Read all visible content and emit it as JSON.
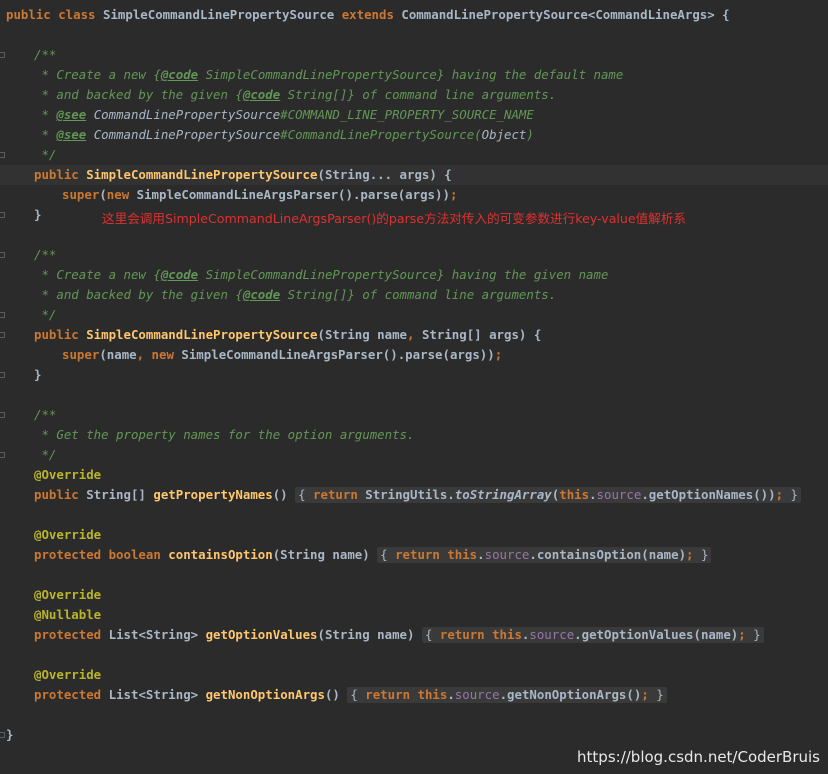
{
  "lines": [
    {
      "id": "class-decl",
      "indent": 0,
      "tokens": [
        {
          "t": "public class ",
          "c": "kw"
        },
        {
          "t": "SimpleCommandLinePropertySource ",
          "c": "cls"
        },
        {
          "t": "extends ",
          "c": "kw"
        },
        {
          "t": "CommandLinePropertySource<CommandLineArgs> {",
          "c": "cls"
        }
      ]
    },
    {
      "id": "blank-1",
      "indent": 0,
      "tokens": []
    },
    {
      "id": "doc1-open",
      "indent": 1,
      "tokens": [
        {
          "t": "/**",
          "c": "cm"
        }
      ]
    },
    {
      "id": "doc1-l1",
      "indent": 1,
      "tokens": [
        {
          "t": " * Create a new ",
          "c": "cm"
        },
        {
          "t": "{",
          "c": "cm"
        },
        {
          "t": "@code",
          "c": "cm-tag"
        },
        {
          "t": " SimpleCommandLinePropertySource} having the default name",
          "c": "cm"
        }
      ]
    },
    {
      "id": "doc1-l2",
      "indent": 1,
      "tokens": [
        {
          "t": " * and backed by the given ",
          "c": "cm"
        },
        {
          "t": "{",
          "c": "cm"
        },
        {
          "t": "@code",
          "c": "cm-tag"
        },
        {
          "t": " String[]} of command line arguments.",
          "c": "cm"
        }
      ]
    },
    {
      "id": "doc1-l3",
      "indent": 1,
      "tokens": [
        {
          "t": " * ",
          "c": "cm"
        },
        {
          "t": "@see",
          "c": "cm-tag"
        },
        {
          "t": " CommandLinePropertySource",
          "c": "cm-ref"
        },
        {
          "t": "#COMMAND_LINE_PROPERTY_SOURCE_NAME",
          "c": "cm"
        }
      ]
    },
    {
      "id": "doc1-l4",
      "indent": 1,
      "tokens": [
        {
          "t": " * ",
          "c": "cm"
        },
        {
          "t": "@see",
          "c": "cm-tag"
        },
        {
          "t": " CommandLinePropertySource",
          "c": "cm-ref"
        },
        {
          "t": "#CommandLinePropertySource(",
          "c": "cm"
        },
        {
          "t": "Object",
          "c": "cm-ref"
        },
        {
          "t": ")",
          "c": "cm"
        }
      ]
    },
    {
      "id": "doc1-close",
      "indent": 1,
      "tokens": [
        {
          "t": " */",
          "c": "cm"
        }
      ]
    },
    {
      "id": "ctor1-sig",
      "indent": 1,
      "current": true,
      "tokens": [
        {
          "t": "public ",
          "c": "kw"
        },
        {
          "t": "SimpleCommandLinePropertySource",
          "c": "fn"
        },
        {
          "t": "(String... args) {",
          "c": "plain-b"
        }
      ]
    },
    {
      "id": "ctor1-body",
      "indent": 2,
      "tokens": [
        {
          "t": "super",
          "c": "kw"
        },
        {
          "t": "(",
          "c": "plain-b"
        },
        {
          "t": "new ",
          "c": "kw"
        },
        {
          "t": "SimpleCommandLineArgsParser().parse(args))",
          "c": "plain-b"
        },
        {
          "t": ";",
          "c": "kw"
        }
      ]
    },
    {
      "id": "ctor1-close",
      "indent": 1,
      "tokens": [
        {
          "t": "}",
          "c": "plain-b"
        }
      ]
    },
    {
      "id": "blank-2",
      "indent": 0,
      "tokens": []
    },
    {
      "id": "doc2-open",
      "indent": 1,
      "tokens": [
        {
          "t": "/**",
          "c": "cm"
        }
      ]
    },
    {
      "id": "doc2-l1",
      "indent": 1,
      "tokens": [
        {
          "t": " * Create a new ",
          "c": "cm"
        },
        {
          "t": "{",
          "c": "cm"
        },
        {
          "t": "@code",
          "c": "cm-tag"
        },
        {
          "t": " SimpleCommandLinePropertySource} having the given name",
          "c": "cm"
        }
      ]
    },
    {
      "id": "doc2-l2",
      "indent": 1,
      "tokens": [
        {
          "t": " * and backed by the given ",
          "c": "cm"
        },
        {
          "t": "{",
          "c": "cm"
        },
        {
          "t": "@code",
          "c": "cm-tag"
        },
        {
          "t": " String[]} of command line arguments.",
          "c": "cm"
        }
      ]
    },
    {
      "id": "doc2-close",
      "indent": 1,
      "tokens": [
        {
          "t": " */",
          "c": "cm"
        }
      ]
    },
    {
      "id": "ctor2-sig",
      "indent": 1,
      "tokens": [
        {
          "t": "public ",
          "c": "kw"
        },
        {
          "t": "SimpleCommandLinePropertySource",
          "c": "fn"
        },
        {
          "t": "(String name",
          "c": "plain-b"
        },
        {
          "t": ", ",
          "c": "kw"
        },
        {
          "t": "String[] args) {",
          "c": "plain-b"
        }
      ]
    },
    {
      "id": "ctor2-body",
      "indent": 2,
      "tokens": [
        {
          "t": "super",
          "c": "kw"
        },
        {
          "t": "(name",
          "c": "plain-b"
        },
        {
          "t": ", ",
          "c": "kw"
        },
        {
          "t": "new ",
          "c": "kw"
        },
        {
          "t": "SimpleCommandLineArgsParser().parse(args))",
          "c": "plain-b"
        },
        {
          "t": ";",
          "c": "kw"
        }
      ]
    },
    {
      "id": "ctor2-close",
      "indent": 1,
      "tokens": [
        {
          "t": "}",
          "c": "plain-b"
        }
      ]
    },
    {
      "id": "blank-3",
      "indent": 0,
      "tokens": []
    },
    {
      "id": "doc3-open",
      "indent": 1,
      "tokens": [
        {
          "t": "/**",
          "c": "cm"
        }
      ]
    },
    {
      "id": "doc3-l1",
      "indent": 1,
      "tokens": [
        {
          "t": " * Get the property names for the option arguments.",
          "c": "cm"
        }
      ]
    },
    {
      "id": "doc3-close",
      "indent": 1,
      "tokens": [
        {
          "t": " */",
          "c": "cm"
        }
      ]
    },
    {
      "id": "ann-1",
      "indent": 1,
      "tokens": [
        {
          "t": "@Override",
          "c": "ann"
        }
      ]
    },
    {
      "id": "m1",
      "indent": 1,
      "tokens": [
        {
          "t": "public ",
          "c": "kw"
        },
        {
          "t": "String[] ",
          "c": "plain-b"
        },
        {
          "t": "getPropertyNames",
          "c": "fn"
        },
        {
          "t": "() ",
          "c": "plain-b"
        },
        {
          "fold": [
            {
              "t": "{ ",
              "c": "plain"
            },
            {
              "t": "return ",
              "c": "kw"
            },
            {
              "t": "StringUtils.",
              "c": "plain-b"
            },
            {
              "t": "toStringArray",
              "c": "static-call"
            },
            {
              "t": "(",
              "c": "plain-b"
            },
            {
              "t": "this",
              "c": "kw"
            },
            {
              "t": ".",
              "c": "plain-b"
            },
            {
              "t": "source",
              "c": "fld"
            },
            {
              "t": ".getOptionNames())",
              "c": "plain-b"
            },
            {
              "t": ";",
              "c": "kw"
            },
            {
              "t": " }",
              "c": "plain"
            }
          ]
        }
      ]
    },
    {
      "id": "blank-4",
      "indent": 0,
      "tokens": []
    },
    {
      "id": "ann-2",
      "indent": 1,
      "tokens": [
        {
          "t": "@Override",
          "c": "ann"
        }
      ]
    },
    {
      "id": "m2",
      "indent": 1,
      "tokens": [
        {
          "t": "protected boolean ",
          "c": "kw"
        },
        {
          "t": "containsOption",
          "c": "fn"
        },
        {
          "t": "(String name) ",
          "c": "plain-b"
        },
        {
          "fold": [
            {
              "t": "{ ",
              "c": "plain"
            },
            {
              "t": "return this",
              "c": "kw"
            },
            {
              "t": ".",
              "c": "plain-b"
            },
            {
              "t": "source",
              "c": "fld"
            },
            {
              "t": ".containsOption(name)",
              "c": "plain-b"
            },
            {
              "t": ";",
              "c": "kw"
            },
            {
              "t": " }",
              "c": "plain"
            }
          ]
        }
      ]
    },
    {
      "id": "blank-5",
      "indent": 0,
      "tokens": []
    },
    {
      "id": "ann-3",
      "indent": 1,
      "tokens": [
        {
          "t": "@Override",
          "c": "ann"
        }
      ]
    },
    {
      "id": "ann-4",
      "indent": 1,
      "tokens": [
        {
          "t": "@Nullable",
          "c": "ann"
        }
      ]
    },
    {
      "id": "m3",
      "indent": 1,
      "tokens": [
        {
          "t": "protected ",
          "c": "kw"
        },
        {
          "t": "List<String> ",
          "c": "plain-b"
        },
        {
          "t": "getOptionValues",
          "c": "fn"
        },
        {
          "t": "(String name) ",
          "c": "plain-b"
        },
        {
          "fold": [
            {
              "t": "{ ",
              "c": "plain"
            },
            {
              "t": "return this",
              "c": "kw"
            },
            {
              "t": ".",
              "c": "plain-b"
            },
            {
              "t": "source",
              "c": "fld"
            },
            {
              "t": ".getOptionValues(name)",
              "c": "plain-b"
            },
            {
              "t": ";",
              "c": "kw"
            },
            {
              "t": " }",
              "c": "plain"
            }
          ]
        }
      ]
    },
    {
      "id": "blank-6",
      "indent": 0,
      "tokens": []
    },
    {
      "id": "ann-5",
      "indent": 1,
      "tokens": [
        {
          "t": "@Override",
          "c": "ann"
        }
      ]
    },
    {
      "id": "m4",
      "indent": 1,
      "tokens": [
        {
          "t": "protected ",
          "c": "kw"
        },
        {
          "t": "List<String> ",
          "c": "plain-b"
        },
        {
          "t": "getNonOptionArgs",
          "c": "fn"
        },
        {
          "t": "() ",
          "c": "plain-b"
        },
        {
          "fold": [
            {
              "t": "{ ",
              "c": "plain"
            },
            {
              "t": "return this",
              "c": "kw"
            },
            {
              "t": ".",
              "c": "plain-b"
            },
            {
              "t": "source",
              "c": "fld"
            },
            {
              "t": ".getNonOptionArgs()",
              "c": "plain-b"
            },
            {
              "t": ";",
              "c": "kw"
            },
            {
              "t": " }",
              "c": "plain"
            }
          ]
        }
      ]
    },
    {
      "id": "blank-7",
      "indent": 0,
      "tokens": []
    },
    {
      "id": "class-close",
      "indent": 0,
      "tokens": [
        {
          "t": "}",
          "c": "plain-b"
        }
      ]
    }
  ],
  "annotation": {
    "text": "这里会调用SimpleCommandLineArgsParser()的parse方法对传入的可变参数进行key-value值解析系",
    "color": "#e0302f"
  },
  "watermark": "https://blog.csdn.net/CoderBruis",
  "colors": {
    "background": "#2b2b2b",
    "current_line": "#323232",
    "keyword": "#cc7832",
    "method": "#ffc66d",
    "field": "#9876aa",
    "annotation": "#bbb529",
    "comment": "#629755",
    "text": "#a9b7c6"
  }
}
